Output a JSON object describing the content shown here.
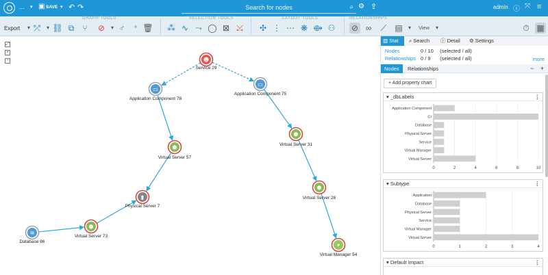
{
  "topbar": {
    "menu_label": "...",
    "save_label": "SAVE",
    "search_placeholder": "Search for nodes",
    "user": "admin"
  },
  "toolbar": {
    "export_label": "Export",
    "groups": [
      "GRAPH TOOLS",
      "SELECTION TOOLS",
      "LAYOUT TOOLS",
      "RELATIONSHIPS"
    ],
    "view_label": "View"
  },
  "graph": {
    "nodes": [
      {
        "label": "Service 29",
        "type": "service"
      },
      {
        "label": "Application Component 78",
        "type": "application"
      },
      {
        "label": "Application Component 75",
        "type": "application"
      },
      {
        "label": "Virtual Server 57",
        "type": "virtual-server"
      },
      {
        "label": "Virtual Server 31",
        "type": "virtual-server"
      },
      {
        "label": "Physical Server 7",
        "type": "physical-server"
      },
      {
        "label": "Virtual Server 28",
        "type": "virtual-server"
      },
      {
        "label": "Database 86",
        "type": "database"
      },
      {
        "label": "Virtual Server 73",
        "type": "virtual-server"
      },
      {
        "label": "Virtual Manager 54",
        "type": "virtual-manager"
      }
    ],
    "edges": [
      {
        "from": "Service 29",
        "to": "Application Component 78",
        "style": "dashed"
      },
      {
        "from": "Service 29",
        "to": "Application Component 75",
        "style": "dashed"
      },
      {
        "from": "Application Component 78",
        "to": "Virtual Server 57",
        "style": "solid"
      },
      {
        "from": "Application Component 75",
        "to": "Virtual Server 31",
        "style": "solid"
      },
      {
        "from": "Virtual Server 57",
        "to": "Physical Server 7",
        "style": "solid"
      },
      {
        "from": "Virtual Server 31",
        "to": "Virtual Server 28",
        "style": "solid"
      },
      {
        "from": "Virtual Server 73",
        "to": "Physical Server 7",
        "style": "solid"
      },
      {
        "from": "Database 86",
        "to": "Virtual Server 73",
        "style": "solid"
      },
      {
        "from": "Virtual Server 28",
        "to": "Virtual Manager 54",
        "style": "solid"
      }
    ]
  },
  "panel": {
    "tabs": [
      "Stat",
      "Search",
      "Detail",
      "Settings"
    ],
    "nodes_label": "Nodes",
    "nodes_count": "0 / 10",
    "rels_label": "Relationships",
    "rels_count": "0 / 9",
    "selected_note": "(selected / all)",
    "more_label": "more",
    "subtabs": [
      "Nodes",
      "Relationships"
    ],
    "add_chart_label": "Add property chart"
  },
  "chart_data": [
    {
      "type": "bar",
      "orientation": "horizontal",
      "title": "_dbLabels",
      "categories": [
        "Application Component",
        "CI",
        "Database",
        "Physical Server",
        "Service",
        "Virtual Manager",
        "Virtual Server"
      ],
      "values": [
        2,
        10,
        1,
        1,
        1,
        1,
        4
      ],
      "xlim": [
        0,
        10
      ],
      "xticks": [
        0,
        2,
        4,
        6,
        8,
        10
      ]
    },
    {
      "type": "bar",
      "orientation": "horizontal",
      "title": "Subtype",
      "categories": [
        "Application",
        "Database",
        "Physical Server",
        "Service",
        "Virtual Manager",
        "Virtual Server"
      ],
      "values": [
        2,
        1,
        1,
        1,
        1,
        4
      ],
      "xlim": [
        0,
        4
      ],
      "xticks": [
        0,
        1,
        2,
        3,
        4
      ]
    },
    {
      "type": "bar",
      "orientation": "horizontal",
      "title": "Default Impact",
      "categories": [],
      "values": []
    }
  ],
  "colors": {
    "brand": "#1f97d6",
    "edge": "#29a8e0",
    "node_ring": "#d9463b",
    "bar": "#cfcfcf"
  }
}
